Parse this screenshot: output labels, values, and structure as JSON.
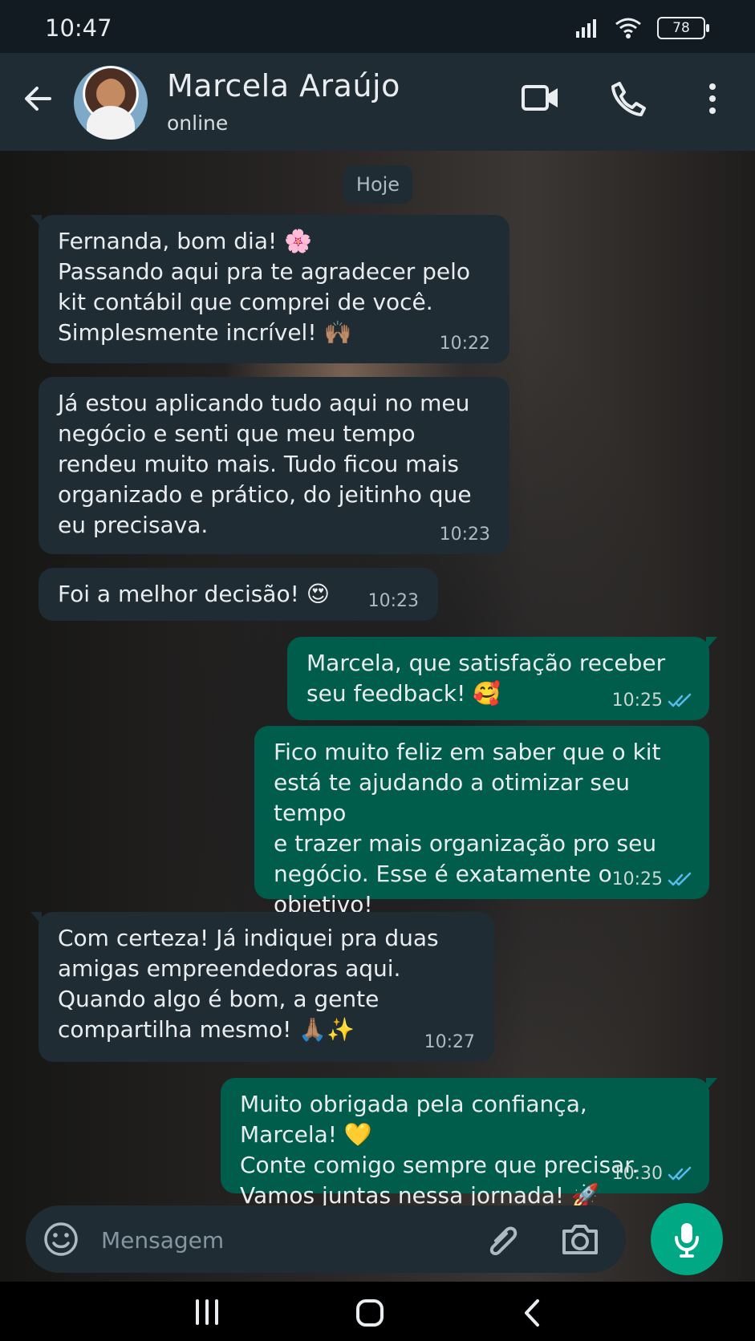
{
  "status_bar": {
    "time": "10:47",
    "battery": "78",
    "icons": [
      "signal-icon",
      "wifi-icon",
      "battery-icon"
    ]
  },
  "header": {
    "contact_name": "Marcela Araújo",
    "contact_status": "online",
    "actions": [
      "back-arrow-icon",
      "video-call-icon",
      "phone-icon",
      "more-vertical-icon"
    ]
  },
  "chat": {
    "date_label": "Hoje",
    "messages": [
      {
        "direction": "in",
        "text": "Fernanda, bom dia! 🌸\nPassando aqui pra te agradecer pelo\nkit contábil que comprei de você.\nSimplesmente incrível! 🙌🏽",
        "time": "10:22"
      },
      {
        "direction": "in",
        "text": "Já estou aplicando tudo aqui no meu\nnegócio e senti que meu tempo\nrendeu muito mais. Tudo ficou mais\norganizado e prático, do jeitinho que\neu precisava.",
        "time": "10:23"
      },
      {
        "direction": "in",
        "text": "Foi a melhor decisão! 😍",
        "time": "10:23"
      },
      {
        "direction": "out",
        "text": "Marcela, que satisfação receber\nseu feedback! 🥰",
        "time": "10:25",
        "status": "read"
      },
      {
        "direction": "out",
        "text": "Fico muito feliz em saber que o kit\nestá te ajudando a otimizar seu tempo\ne trazer mais organização pro seu\nnegócio. Esse é exatamente o objetivo!",
        "time": "10:25",
        "status": "read"
      },
      {
        "direction": "in",
        "text": "Com certeza! Já indiquei pra duas\namigas empreendedoras aqui.\nQuando algo é bom, a gente\ncompartilha mesmo! 🙏🏽✨",
        "time": "10:27"
      },
      {
        "direction": "out",
        "text": "Muito obrigada pela confiança, Marcela! 💛\nConte comigo sempre que precisar.\nVamos juntas nessa jornada! 🚀",
        "time": "10:30",
        "status": "read"
      }
    ]
  },
  "input": {
    "placeholder": "Mensagem",
    "icons": [
      "emoji-icon",
      "attach-icon",
      "camera-icon",
      "mic-icon"
    ]
  },
  "navigation": {
    "icons": [
      "recent-apps-icon",
      "home-icon",
      "back-icon"
    ]
  },
  "colors": {
    "header": "#1f2c34",
    "incoming_bubble": "#1f2c34",
    "outgoing_bubble": "#005c4b",
    "read_ticks": "#53bdeb",
    "accent": "#00a884"
  }
}
